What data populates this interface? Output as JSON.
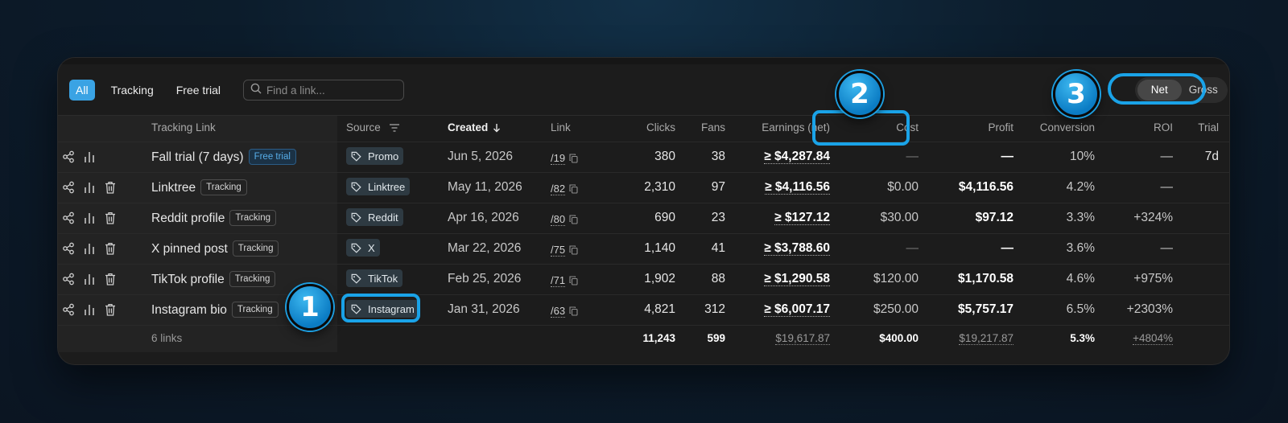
{
  "filters": {
    "tabs": [
      "All",
      "Tracking",
      "Free trial"
    ],
    "active": "All"
  },
  "search": {
    "placeholder": "Find a link..."
  },
  "toggle": {
    "options": [
      "Net",
      "Gross"
    ],
    "active": "Net"
  },
  "columns": {
    "tracking_link": "Tracking Link",
    "source": "Source",
    "created": "Created",
    "link": "Link",
    "clicks": "Clicks",
    "fans": "Fans",
    "earnings": "Earnings (net)",
    "cost": "Cost",
    "profit": "Profit",
    "conversion": "Conversion",
    "roi": "ROI",
    "trial": "Trial"
  },
  "rows": [
    {
      "name": "Fall trial (7 days)",
      "badge": "Free trial",
      "source": "Promo",
      "created": "Jun 5, 2026",
      "link": "/19",
      "clicks": "380",
      "fans": "38",
      "earnings": "≥ $4,287.84",
      "cost": "—",
      "profit": "—",
      "conversion": "10%",
      "roi": "—",
      "trial": "7d"
    },
    {
      "name": "Linktree",
      "badge": "Tracking",
      "source": "Linktree",
      "created": "May 11, 2026",
      "link": "/82",
      "clicks": "2,310",
      "fans": "97",
      "earnings": "≥ $4,116.56",
      "cost": "$0.00",
      "profit": "$4,116.56",
      "conversion": "4.2%",
      "roi": "—",
      "trial": ""
    },
    {
      "name": "Reddit profile",
      "badge": "Tracking",
      "source": "Reddit",
      "created": "Apr 16, 2026",
      "link": "/80",
      "clicks": "690",
      "fans": "23",
      "earnings": "≥ $127.12",
      "cost": "$30.00",
      "profit": "$97.12",
      "conversion": "3.3%",
      "roi": "+324%",
      "trial": ""
    },
    {
      "name": "X pinned post",
      "badge": "Tracking",
      "source": "X",
      "created": "Mar 22, 2026",
      "link": "/75",
      "clicks": "1,140",
      "fans": "41",
      "earnings": "≥ $3,788.60",
      "cost": "—",
      "profit": "—",
      "conversion": "3.6%",
      "roi": "—",
      "trial": ""
    },
    {
      "name": "TikTok profile",
      "badge": "Tracking",
      "source": "TikTok",
      "created": "Feb 25, 2026",
      "link": "/71",
      "clicks": "1,902",
      "fans": "88",
      "earnings": "≥ $1,290.58",
      "cost": "$120.00",
      "profit": "$1,170.58",
      "conversion": "4.6%",
      "roi": "+975%",
      "trial": ""
    },
    {
      "name": "Instagram bio",
      "badge": "Tracking",
      "source": "Instagram",
      "created": "Jan 31, 2026",
      "link": "/63",
      "clicks": "4,821",
      "fans": "312",
      "earnings": "≥ $6,007.17",
      "cost": "$250.00",
      "profit": "$5,757.17",
      "conversion": "6.5%",
      "roi": "+2303%",
      "trial": ""
    }
  ],
  "footer": {
    "count": "6 links",
    "clicks": "11,243",
    "fans": "599",
    "earnings": "$19,617.87",
    "cost": "$400.00",
    "profit": "$19,217.87",
    "conversion": "5.3%",
    "roi": "+4804%"
  },
  "markers": [
    "1",
    "2",
    "3"
  ],
  "colors": {
    "accent": "#1aa3e8",
    "active_tab": "#3aa3e4",
    "panel": "#1c1c1c"
  }
}
